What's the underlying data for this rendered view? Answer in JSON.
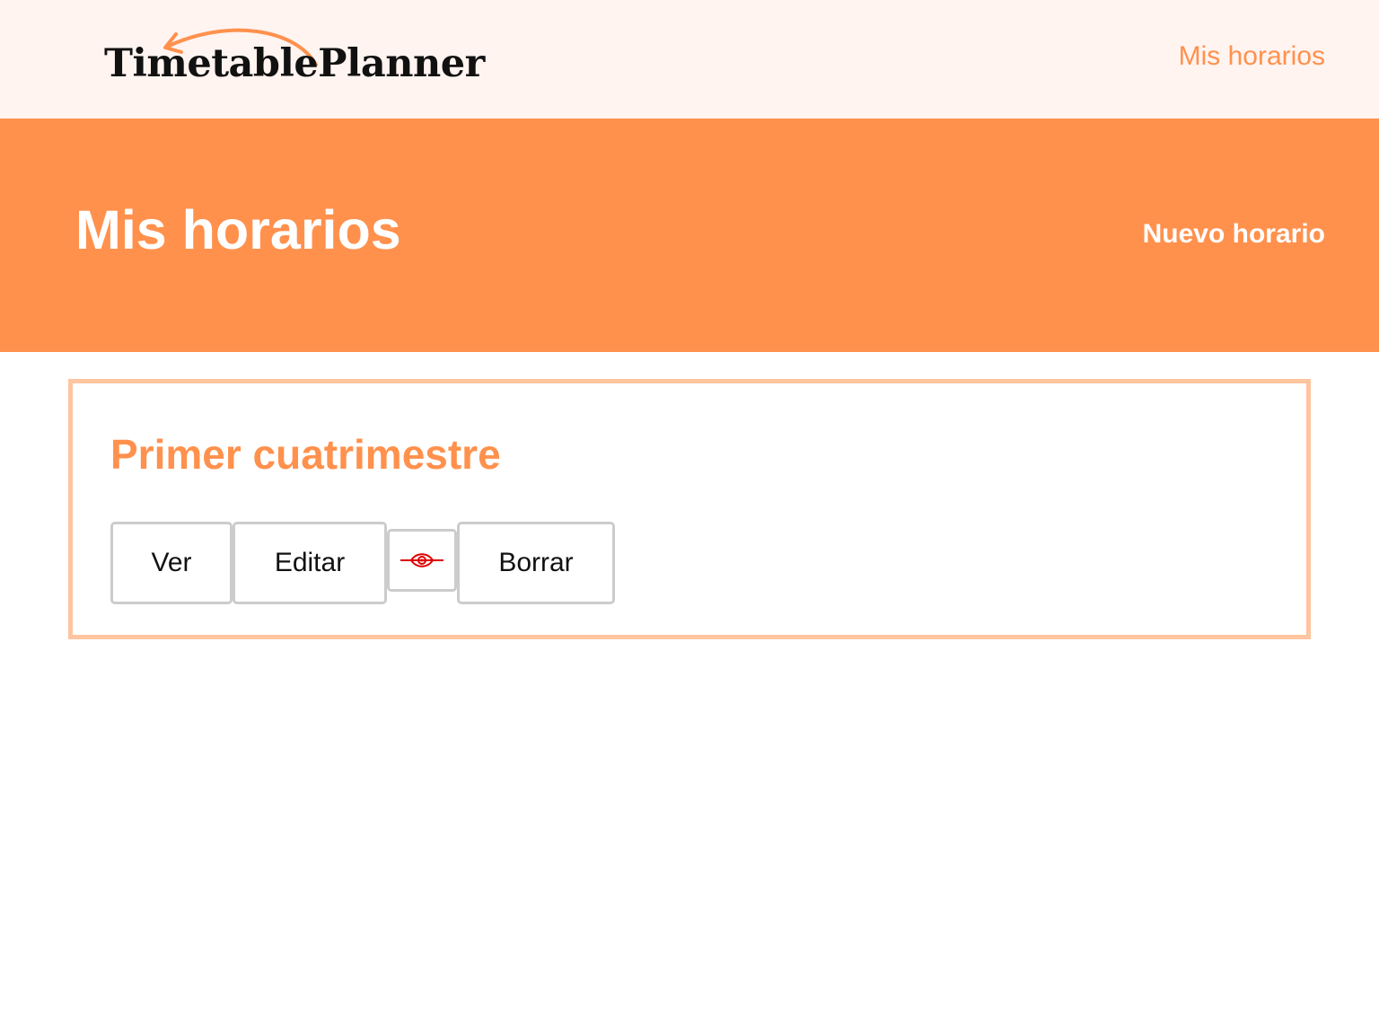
{
  "header": {
    "logo_text": "TimetablePlanner",
    "nav_link": "Mis horarios"
  },
  "banner": {
    "title": "Mis horarios",
    "new_link": "Nuevo horario"
  },
  "schedules": [
    {
      "title": "Primer cuatrimestre",
      "actions": {
        "view_label": "Ver",
        "edit_label": "Editar",
        "visibility_icon": "eye-slash-icon",
        "delete_label": "Borrar"
      }
    }
  ],
  "colors": {
    "accent": "#ff914d",
    "topbar_bg": "#fff4f0",
    "card_border": "#ffc59f",
    "visibility_icon": "#e00000"
  }
}
